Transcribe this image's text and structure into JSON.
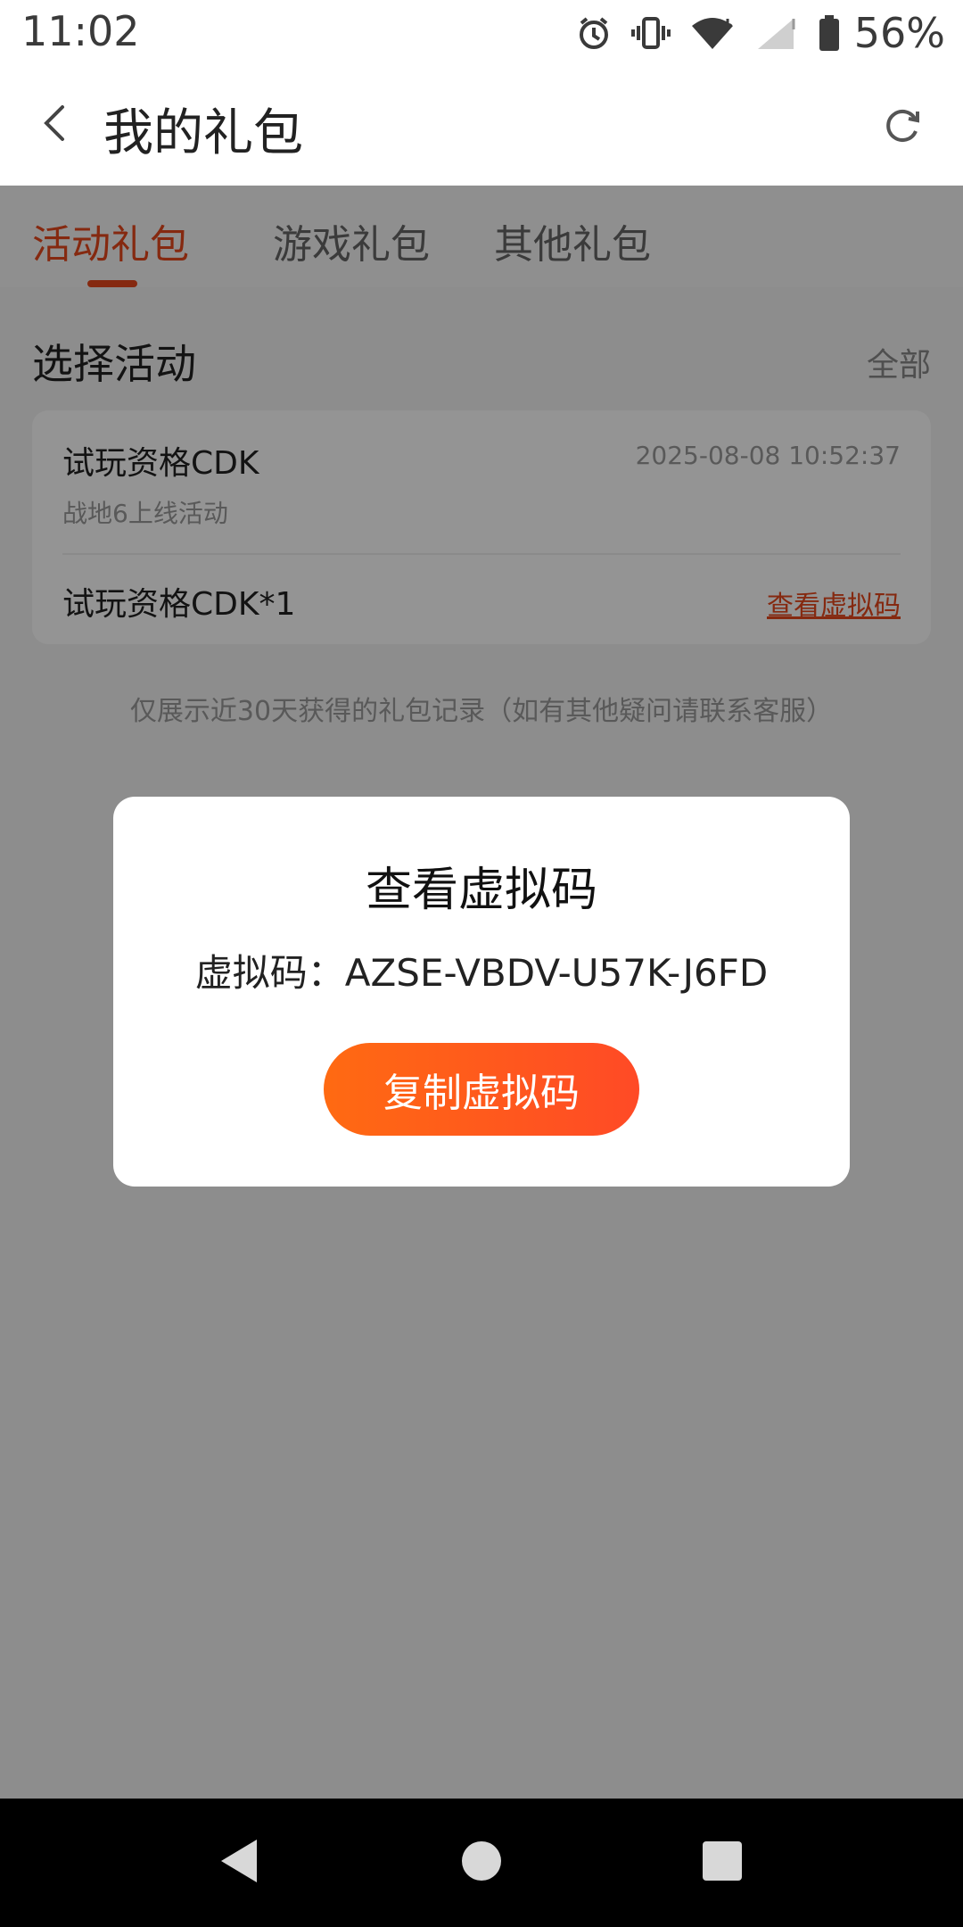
{
  "status_bar": {
    "time": "11:02",
    "battery": "56%"
  },
  "app_bar": {
    "title": "我的礼包"
  },
  "tabs": [
    {
      "label": "活动礼包",
      "active": true
    },
    {
      "label": "游戏礼包",
      "active": false
    },
    {
      "label": "其他礼包",
      "active": false
    }
  ],
  "section": {
    "title": "选择活动",
    "filter_label": "全部"
  },
  "gift_card": {
    "name": "试玩资格CDK",
    "time": "2025-08-08 10:52:37",
    "event": "战地6上线活动",
    "item": "试玩资格CDK*1",
    "view_code_label": "查看虚拟码"
  },
  "note": "仅展示近30天获得的礼包记录（如有其他疑问请联系客服）",
  "dialog": {
    "title": "查看虚拟码",
    "code_text": "虚拟码：AZSE-VBDV-U57K-J6FD",
    "copy_button": "复制虚拟码"
  },
  "colors": {
    "accent": "#e5481c",
    "button_start": "#ff6a12",
    "button_end": "#ff4a26"
  }
}
